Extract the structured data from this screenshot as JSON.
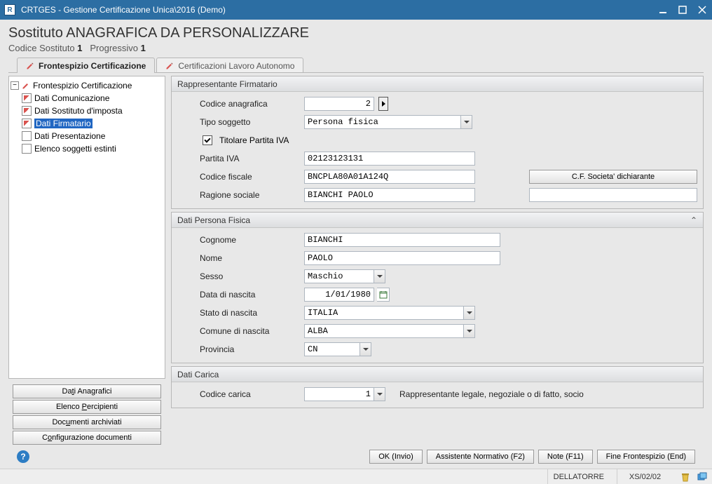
{
  "window": {
    "title": "CRTGES - Gestione Certificazione Unica\\2016  (Demo)",
    "appiconLetter": "R"
  },
  "header": {
    "pageTitle": "Sostituto ANAGRAFICA DA PERSONALIZZARE",
    "sub_codice_label": "Codice Sostituto",
    "sub_codice_value": "1",
    "sub_prog_label": "Progressivo",
    "sub_prog_value": "1"
  },
  "tabs": {
    "frontespizio": "Frontespizio Certificazione",
    "certificazioni": "Certificazioni Lavoro Autonomo"
  },
  "tree": {
    "root": "Frontespizio Certificazione",
    "items": [
      {
        "label": "Dati Comunicazione",
        "edit": true
      },
      {
        "label": "Dati Sostituto d'imposta",
        "edit": true
      },
      {
        "label": "Dati Firmatario",
        "edit": true,
        "selected": true
      },
      {
        "label": "Dati Presentazione",
        "edit": false
      },
      {
        "label": "Elenco soggetti estinti",
        "edit": false
      }
    ]
  },
  "leftButtons": {
    "datiAnagrafici": "Dati Anagrafici",
    "elencoPercipienti": "Elenco Percipienti",
    "documentiArchiviati": "Documenti archiviati",
    "configurazione": "Configurazione documenti"
  },
  "rappresentante": {
    "title": "Rappresentante Firmatario",
    "codice_anagrafica_label": "Codice anagrafica",
    "codice_anagrafica_value": "2",
    "tipo_soggetto_label": "Tipo soggetto",
    "tipo_soggetto_value": "Persona fisica",
    "titolare_piva_label": "Titolare Partita IVA",
    "titolare_piva_checked": true,
    "partita_iva_label": "Partita IVA",
    "partita_iva_value": "02123123131",
    "codice_fiscale_label": "Codice fiscale",
    "codice_fiscale_value": "BNCPLA80A01A124Q",
    "cf_button": "C.F. Societa' dichiarante",
    "ragione_sociale_label": "Ragione sociale",
    "ragione_sociale_value": "BIANCHI PAOLO",
    "ragione_sociale_extra": ""
  },
  "persona": {
    "title": "Dati Persona Fisica",
    "cognome_label": "Cognome",
    "cognome_value": "BIANCHI",
    "nome_label": "Nome",
    "nome_value": "PAOLO",
    "sesso_label": "Sesso",
    "sesso_value": "Maschio",
    "data_nascita_label": "Data di nascita",
    "data_nascita_value": "1/01/1980",
    "stato_nascita_label": "Stato di nascita",
    "stato_nascita_value": "ITALIA",
    "comune_nascita_label": "Comune di nascita",
    "comune_nascita_value": "ALBA",
    "provincia_label": "Provincia",
    "provincia_value": "CN"
  },
  "carica": {
    "title": "Dati Carica",
    "codice_carica_label": "Codice carica",
    "codice_carica_value": "1",
    "codice_carica_desc": "Rappresentante legale, negoziale o di fatto, socio"
  },
  "footer": {
    "ok": "OK (Invio)",
    "assistente": "Assistente Normativo (F2)",
    "note": "Note (F11)",
    "fine": "Fine Frontespizio (End)"
  },
  "status": {
    "user": "DELLATORRE",
    "code": "XS/02/02"
  }
}
